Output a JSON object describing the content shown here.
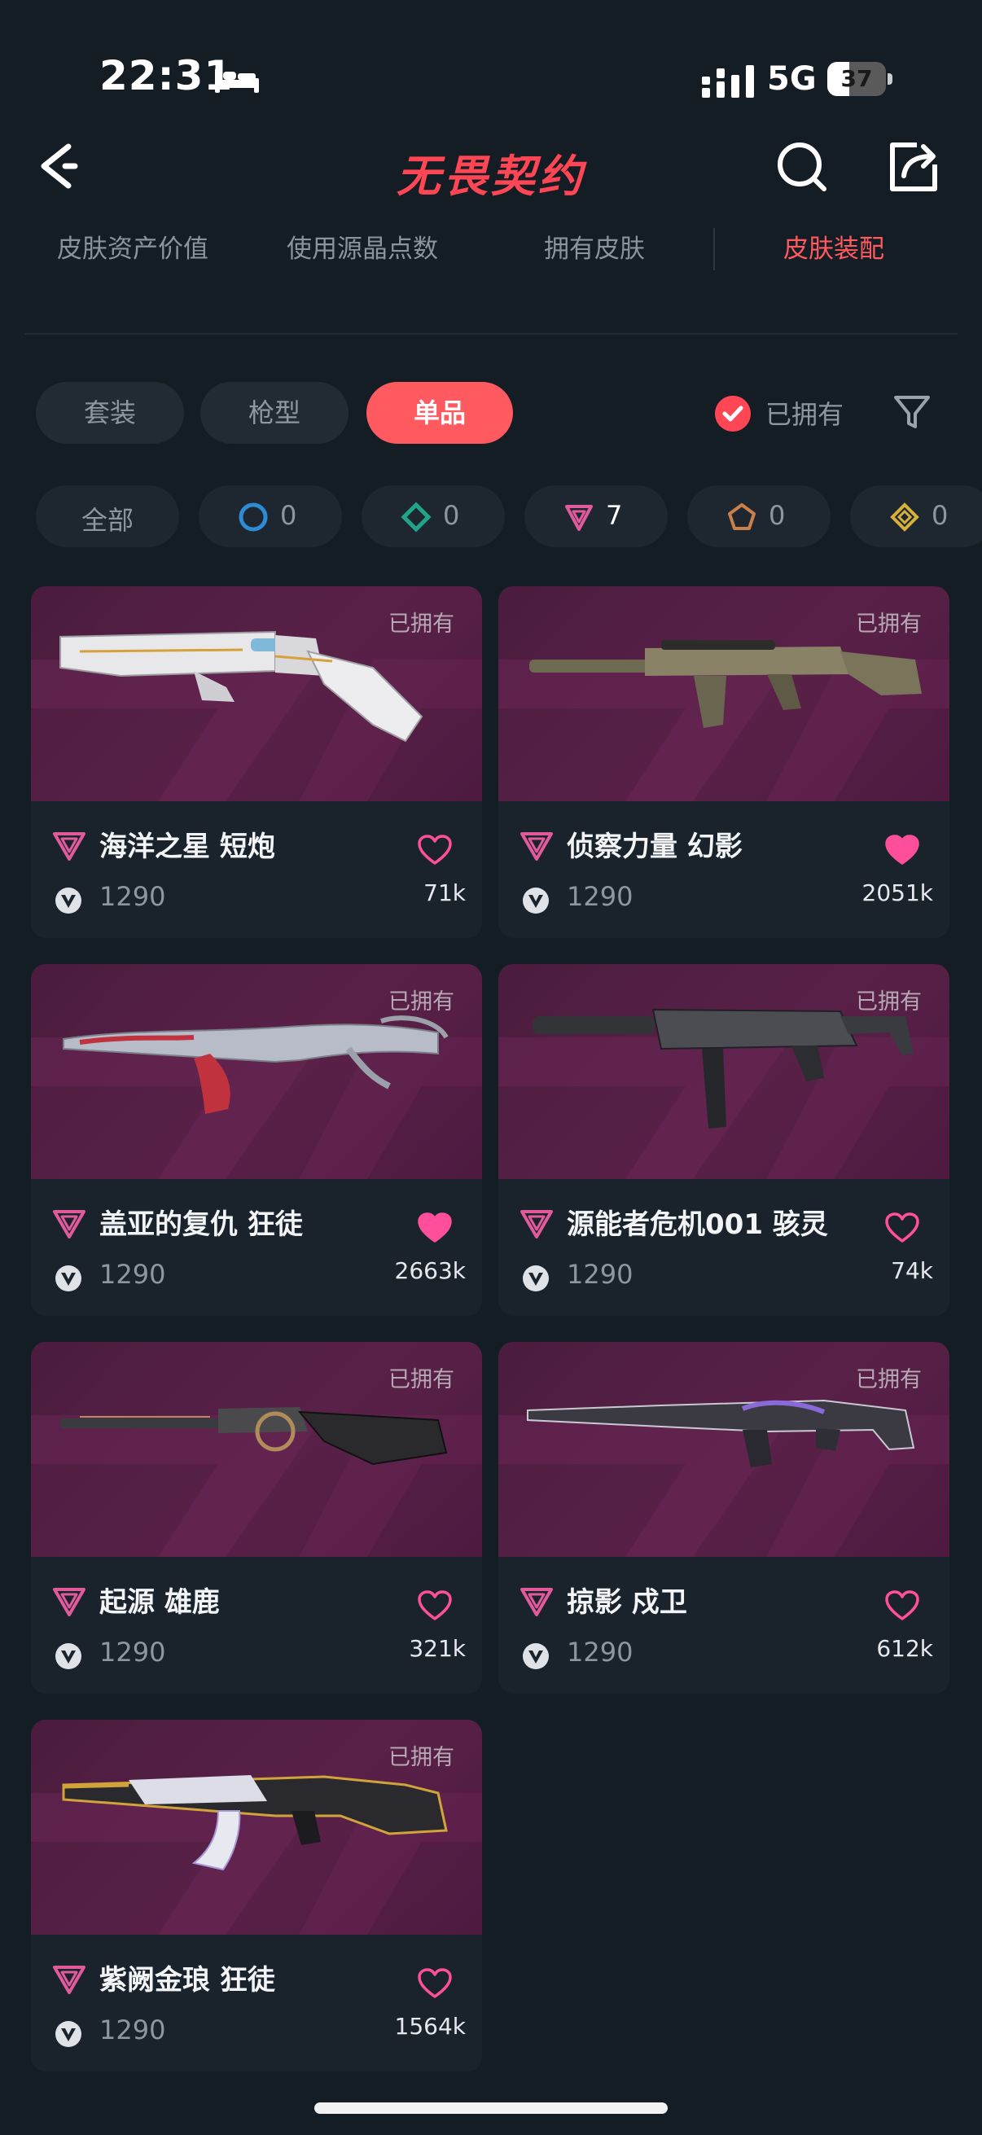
{
  "status": {
    "time": "22:31",
    "network": "5G",
    "battery": 37
  },
  "header": {
    "logo": "无畏契约"
  },
  "top_tabs": [
    {
      "label": "皮肤资产价值",
      "active": false
    },
    {
      "label": "使用源晶点数",
      "active": false
    },
    {
      "label": "拥有皮肤",
      "active": false
    },
    {
      "label": "皮肤装配",
      "active": true
    }
  ],
  "segments": [
    {
      "label": "套装",
      "active": false
    },
    {
      "label": "枪型",
      "active": false
    },
    {
      "label": "单品",
      "active": true
    }
  ],
  "owned_filter": {
    "label": "已拥有",
    "checked": true
  },
  "tier_chips": [
    {
      "label": "全部"
    },
    {
      "icon": "select-tier-icon",
      "count": "0",
      "color": "#2e8bd6"
    },
    {
      "icon": "deluxe-tier-icon",
      "count": "0",
      "color": "#1fa58a"
    },
    {
      "icon": "premium-tier-icon",
      "count": "7",
      "color": "#e05a9c",
      "active": true
    },
    {
      "icon": "exclusive-tier-icon",
      "count": "0",
      "color": "#c9804a"
    },
    {
      "icon": "ultra-tier-icon",
      "count": "0",
      "color": "#d6b03a"
    }
  ],
  "cards": [
    {
      "name": "海洋之星 短炮",
      "price": "1290",
      "likes": "71k",
      "liked": false,
      "owned_tag": "已拥有"
    },
    {
      "name": "侦察力量 幻影",
      "price": "1290",
      "likes": "2051k",
      "liked": true,
      "owned_tag": "已拥有"
    },
    {
      "name": "盖亚的复仇 狂徒",
      "price": "1290",
      "likes": "2663k",
      "liked": true,
      "owned_tag": "已拥有"
    },
    {
      "name": "源能者危机001 骇灵",
      "price": "1290",
      "likes": "74k",
      "liked": false,
      "owned_tag": "已拥有"
    },
    {
      "name": "起源 雄鹿",
      "price": "1290",
      "likes": "321k",
      "liked": false,
      "owned_tag": "已拥有"
    },
    {
      "name": "掠影 戍卫",
      "price": "1290",
      "likes": "612k",
      "liked": false,
      "owned_tag": "已拥有"
    },
    {
      "name": "紫阙金琅 狂徒",
      "price": "1290",
      "likes": "1564k",
      "liked": false,
      "owned_tag": "已拥有"
    }
  ],
  "colors": {
    "accent": "#ff4655",
    "premium": "#e05a9c",
    "card_art": "#4f1d42"
  }
}
